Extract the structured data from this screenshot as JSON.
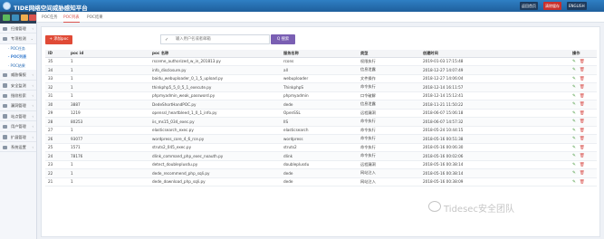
{
  "app": {
    "title": "TIDE网络空间威胁感知平台"
  },
  "topbar": {
    "buttons": [
      "返回首页",
      "清除缓存",
      "ENGLISH"
    ],
    "colors": [
      "#1e3a5c",
      "#c9302c",
      "#1e3a5c"
    ]
  },
  "sidebar": {
    "items": [
      {
        "label": "扫描管理",
        "icon": "scan-icon"
      },
      {
        "label": "专项检测",
        "icon": "target-icon",
        "expanded": true
      }
    ],
    "subitems": [
      "POC任务",
      "POC列表",
      "POC结果"
    ],
    "active_sub": "POC列表",
    "items_after": [
      {
        "label": "威胁情报",
        "icon": "alert-icon"
      },
      {
        "label": "安全监测",
        "icon": "shield-icon"
      },
      {
        "label": "指纹检索",
        "icon": "fingerprint-icon"
      },
      {
        "label": "漏洞管理",
        "icon": "bug-icon"
      },
      {
        "label": "站点管理",
        "icon": "site-icon"
      },
      {
        "label": "用户管理",
        "icon": "user-icon"
      },
      {
        "label": "扩展管理",
        "icon": "extension-icon"
      },
      {
        "label": "系统设置",
        "icon": "settings-icon"
      }
    ]
  },
  "tabs": [
    "POC任务",
    "POC列表",
    "POC结果"
  ],
  "active_tab": "POC列表",
  "toolbar": {
    "add_label": "+ 添加poc",
    "search_placeholder": "输入用户名或者邮箱",
    "search_label": "Q 搜索"
  },
  "table": {
    "headers": [
      "ID",
      "poc id",
      "poc 名称",
      "服务名称",
      "类型",
      "创建时间",
      "操作"
    ],
    "rows": [
      [
        "35",
        "1",
        "rsceme_authorized_w_in_201813.py",
        "rcons",
        "权限执行",
        "2019-01-03 17:15:48"
      ],
      [
        "34",
        "1",
        "info_disclosure.py",
        "all",
        "信息泄露",
        "2018-12-27 14:07:49"
      ],
      [
        "33",
        "1",
        "baidu_webuploader_0_1_5_upload.py",
        "webuploader",
        "文件操作",
        "2018-12-27 14:06:04"
      ],
      [
        "32",
        "1",
        "thinkphp5_5_0_5_1_execute.py",
        "ThinkphpS",
        "命令执行",
        "2018-12-14 16:11:57"
      ],
      [
        "31",
        "1",
        "phpmyadmin_weak_password.py",
        "phpmyadmin",
        "口令破解",
        "2018-12-14 15:12:41"
      ],
      [
        "30",
        "3887",
        "DedeShortHandPOC.py",
        "dede",
        "信息泄露",
        "2018-11-21 11:50:22"
      ],
      [
        "29",
        "1219",
        "openssl_heartbleed_1_0_1_info.py",
        "OpenSSL",
        "远程漏洞",
        "2018-06-07 15:06:18"
      ],
      [
        "28",
        "80253",
        "iis_ms15_034_exec.py",
        "IIS",
        "命令执行",
        "2018-06-07 14:57:32"
      ],
      [
        "27",
        "1",
        "elasticsearch_exec.py",
        "elasticsearch",
        "命令执行",
        "2018-05-24 10:44:15"
      ],
      [
        "26",
        "93077",
        "wordpress_core_4_6_rce.py",
        "wordpress",
        "命令执行",
        "2018-05-16 00:51:38"
      ],
      [
        "25",
        "1571",
        "struts2_045_exec.py",
        "struts2",
        "命令执行",
        "2018-05-16 00:06:30"
      ],
      [
        "24",
        "78176",
        "dlink_command_php_exec_noauth.py",
        "dlink",
        "命令执行",
        "2018-05-16 00:02:06"
      ],
      [
        "23",
        "1",
        "detect_doubleplusdu.py",
        "doubleplusdu",
        "远程漏洞",
        "2018-05-16 00:38:14"
      ],
      [
        "22",
        "1",
        "dede_recommend_php_sqli.py",
        "dede",
        "网站注入",
        "2018-05-16 00:38:14"
      ],
      [
        "21",
        "1",
        "dede_download_php_sqli.py",
        "dede",
        "网站注入",
        "2018-05-16 00:38:09"
      ]
    ]
  },
  "watermark": "Tidesec安全团队"
}
